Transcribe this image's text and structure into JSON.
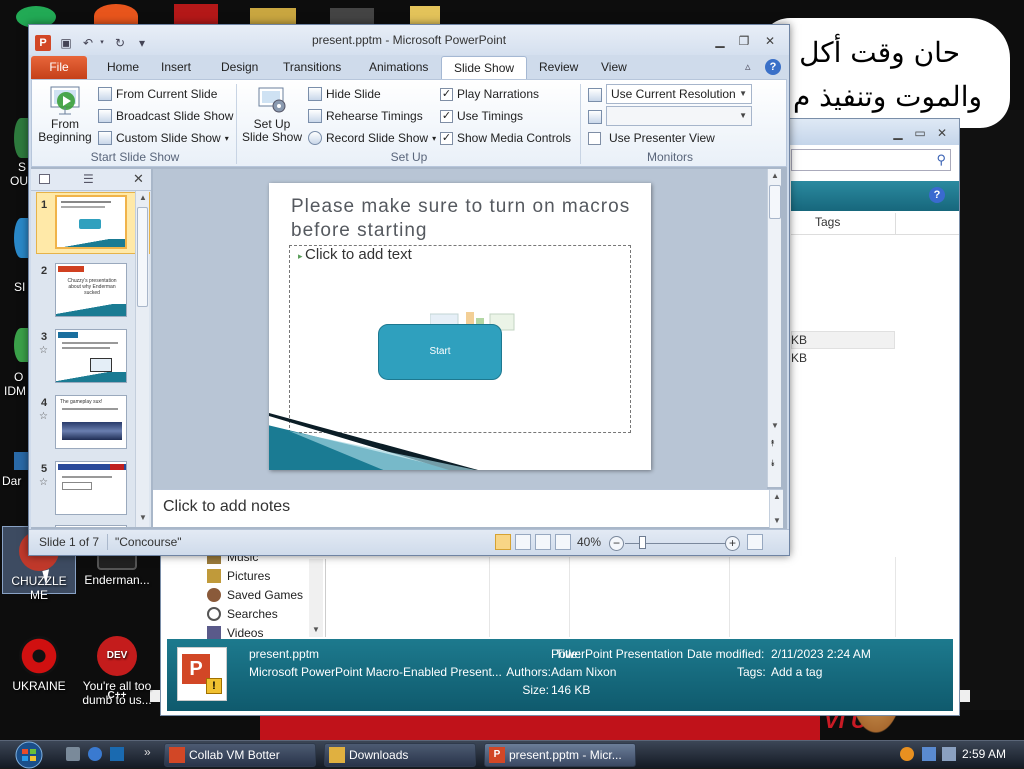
{
  "desktop": {
    "arabic_line1": "حان وقت أكل",
    "arabic_line2": "والموت وتنفيذ م",
    "icons": [
      {
        "label": "CHUZZLE ME"
      },
      {
        "label": "Enderman..."
      },
      {
        "label": "UKRAINE"
      },
      {
        "label": "You're all too dumb to us..."
      }
    ],
    "dev_badge": "DEV C++",
    "partial_labels": [
      "S",
      "OU",
      "SI",
      "O",
      "IDM",
      "Dar"
    ],
    "wallpaper_text": "VI UT"
  },
  "explorer": {
    "column_tags": "Tags",
    "size_fragment_1": "KB",
    "size_fragment_2": "KB",
    "nav_items": [
      "Music",
      "Pictures",
      "Saved Games",
      "Searches",
      "Videos"
    ],
    "details": {
      "filename": "present.pptm",
      "filetype": "Microsoft PowerPoint Macro-Enabled Present...",
      "title_label": "Title:",
      "title_value": "PowerPoint Presentation",
      "authors_label": "Authors:",
      "authors_value": "Adam Nixon",
      "size_label": "Size:",
      "size_value": "146 KB",
      "date_label": "Date modified:",
      "date_value": "2/11/2023 2:24 AM",
      "tags_label": "Tags:",
      "tags_value": "Add a tag"
    }
  },
  "ppt": {
    "title": "present.pptm  -  Microsoft PowerPoint",
    "tabs": {
      "file": "File",
      "home": "Home",
      "insert": "Insert",
      "design": "Design",
      "transitions": "Transitions",
      "animations": "Animations",
      "slideshow": "Slide Show",
      "review": "Review",
      "view": "View"
    },
    "ribbon": {
      "from_beginning": "From Beginning",
      "from_current": "From Current Slide",
      "broadcast": "Broadcast Slide Show",
      "custom": "Custom Slide Show",
      "group_start": "Start Slide Show",
      "setup_show": "Set Up Slide Show",
      "hide_slide": "Hide Slide",
      "rehearse": "Rehearse Timings",
      "record": "Record Slide Show",
      "play_narrations": "Play Narrations",
      "use_timings": "Use Timings",
      "show_media": "Show Media Controls",
      "group_setup": "Set Up",
      "resolution": "Use Current Resolution",
      "presenter_view": "Use Presenter View",
      "group_monitors": "Monitors"
    },
    "slide": {
      "title": "Please make sure to turn on macros before starting",
      "placeholder": "Click to add text",
      "button": "Start"
    },
    "thumbs": [
      "1",
      "2",
      "3",
      "4",
      "5"
    ],
    "thumb_texts": {
      "t2_title": "Chuzzy's presentation about why Enderman sucked",
      "t4_title": "The gameplay sux!"
    },
    "notes": "Click to add notes",
    "status": {
      "slide": "Slide 1 of 7",
      "theme": "\"Concourse\"",
      "zoom": "40%"
    }
  },
  "taskbar": {
    "buttons": [
      "Collab VM Botter",
      "Downloads",
      "present.pptm - Micr..."
    ],
    "time": "2:59 AM"
  },
  "colors": {
    "file_tab": "#d24726",
    "teal": "#2fa0be",
    "details_bg": "#0f5a6d"
  }
}
